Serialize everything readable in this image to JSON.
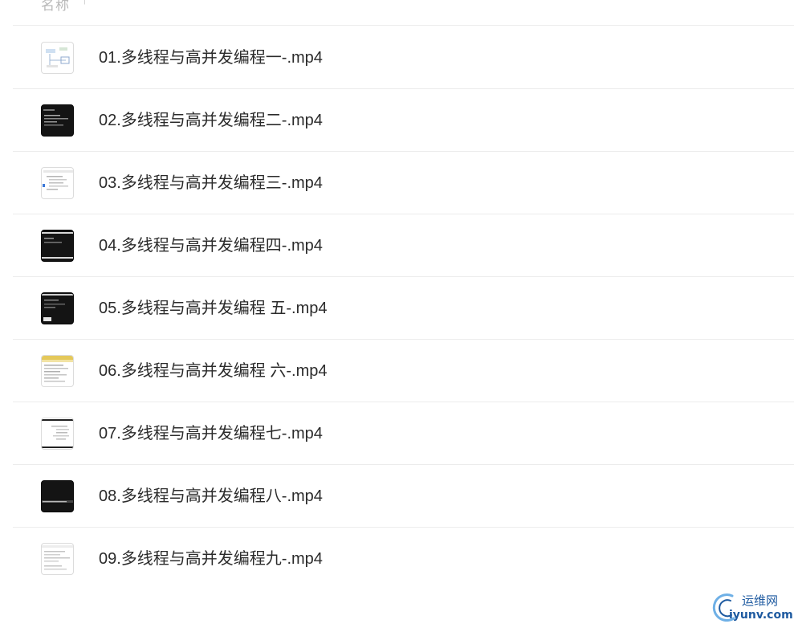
{
  "header": {
    "label": "名称",
    "sort_icon": "arrow-up-icon",
    "sort_glyph": "↑"
  },
  "files": [
    {
      "name": "01.多线程与高并发编程一-.mp4",
      "thumb": "white"
    },
    {
      "name": "02.多线程与高并发编程二-.mp4",
      "thumb": "dark"
    },
    {
      "name": "03.多线程与高并发编程三-.mp4",
      "thumb": "white"
    },
    {
      "name": "04.多线程与高并发编程四-.mp4",
      "thumb": "dark"
    },
    {
      "name": "05.多线程与高并发编程 五-.mp4",
      "thumb": "dark"
    },
    {
      "name": "06.多线程与高并发编程 六-.mp4",
      "thumb": "yellow"
    },
    {
      "name": "07.多线程与高并发编程七-.mp4",
      "thumb": "white"
    },
    {
      "name": "08.多线程与高并发编程八-.mp4",
      "thumb": "dark"
    },
    {
      "name": "09.多线程与高并发编程九-.mp4",
      "thumb": "white"
    }
  ],
  "watermark": {
    "cn": "运维网",
    "en": "iyunv.com",
    "color": "#1e5aa0"
  }
}
